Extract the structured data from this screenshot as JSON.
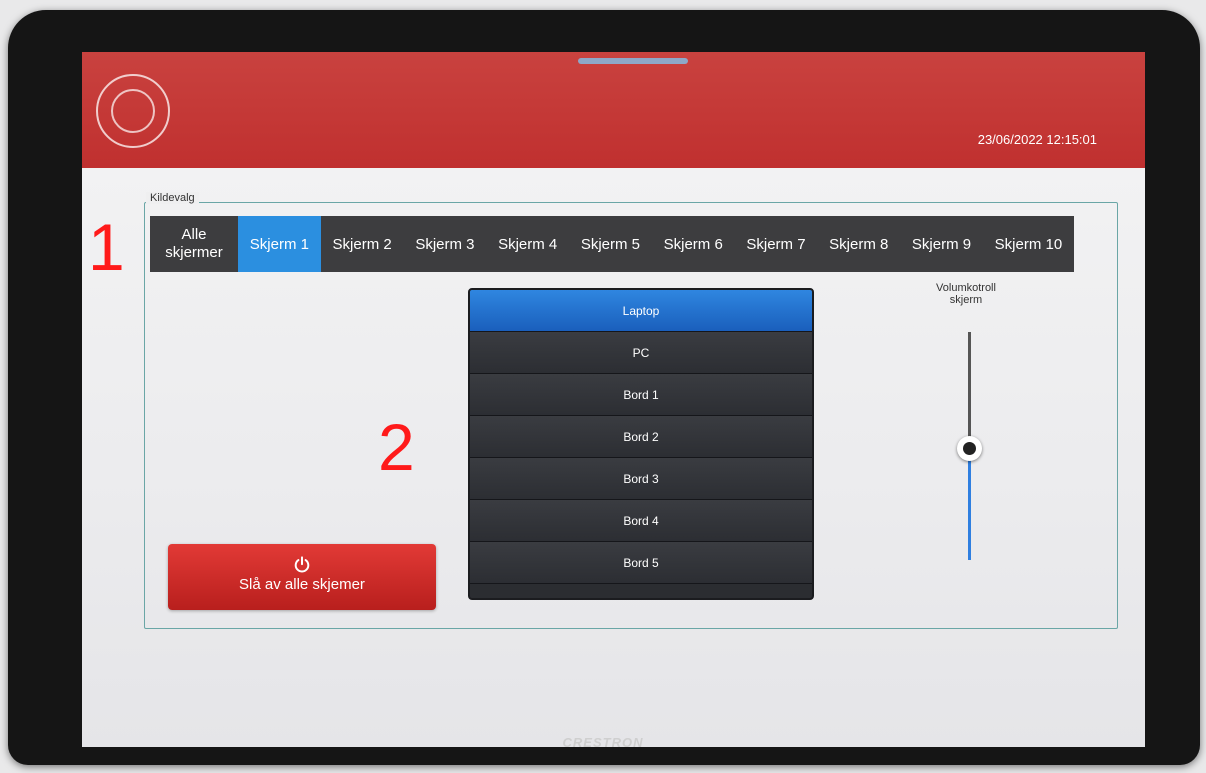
{
  "header": {
    "datetime": "23/06/2022 12:15:01",
    "brand_color": "#c0302f"
  },
  "group": {
    "legend": "Kildevalg"
  },
  "tabs": [
    {
      "label": "Alle skjermer",
      "active": false
    },
    {
      "label": "Skjerm 1",
      "active": true
    },
    {
      "label": "Skjerm 2",
      "active": false
    },
    {
      "label": "Skjerm 3",
      "active": false
    },
    {
      "label": "Skjerm 4",
      "active": false
    },
    {
      "label": "Skjerm 5",
      "active": false
    },
    {
      "label": "Skjerm 6",
      "active": false
    },
    {
      "label": "Skjerm 7",
      "active": false
    },
    {
      "label": "Skjerm 8",
      "active": false
    },
    {
      "label": "Skjerm 9",
      "active": false
    },
    {
      "label": "Skjerm 10",
      "active": false
    }
  ],
  "annotations": {
    "one": "1",
    "two": "2"
  },
  "sources": [
    {
      "label": "Laptop",
      "selected": true
    },
    {
      "label": "PC",
      "selected": false
    },
    {
      "label": "Bord 1",
      "selected": false
    },
    {
      "label": "Bord 2",
      "selected": false
    },
    {
      "label": "Bord 3",
      "selected": false
    },
    {
      "label": "Bord 4",
      "selected": false
    },
    {
      "label": "Bord 5",
      "selected": false
    }
  ],
  "power_button": {
    "label": "Slå av alle skjemer",
    "icon": "power-icon"
  },
  "volume": {
    "label": "Volumkotroll skjerm",
    "level": 0.49
  },
  "device": {
    "brand": "CRESTRON"
  },
  "colors": {
    "accent": "#2b8fe0",
    "tab_bar": "#3d3d3f",
    "danger": "#d22a27",
    "annotation": "#ff1a1a"
  }
}
